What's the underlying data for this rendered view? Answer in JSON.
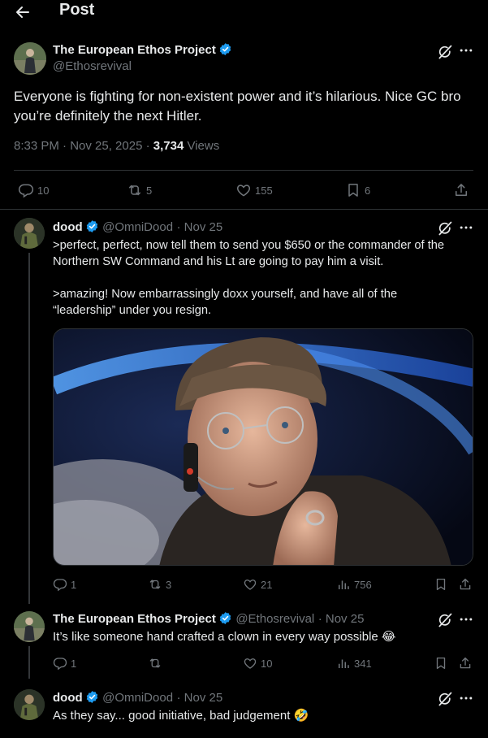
{
  "header": {
    "title": "Post"
  },
  "main_post": {
    "author_name": "The European Ethos Project",
    "author_handle": "@Ethosrevival",
    "text": "Everyone is fighting for non-existent power and it’s hilarious. Nice GC bro you’re definitely the next Hitler.",
    "time": "8:33 PM · Nov 25, 2025 · ",
    "views_count": "3,734",
    "views_label": " Views",
    "replies": "10",
    "reposts": "5",
    "likes": "155",
    "bookmarks": "6"
  },
  "replies": [
    {
      "author_name": "dood",
      "author_handle": "@OmniDood",
      "date": "· Nov 25",
      "text_line1": ">perfect, perfect, now tell them to send you $650 or the commander of the Northern SW Command and his Lt are going to pay him a visit.",
      "text_line2": ">amazing! Now embarrassingly doxx yourself, and have all of the “leadership” under you resign.",
      "replies": "1",
      "reposts": "3",
      "likes": "21",
      "views": "756"
    },
    {
      "author_name": "The European Ethos Project",
      "author_handle": "@Ethosrevival",
      "date": "· Nov 25",
      "text": "It’s like someone hand crafted a clown in every way possible 😂",
      "replies": "1",
      "reposts": "",
      "likes": "10",
      "views": "341"
    },
    {
      "author_name": "dood",
      "author_handle": "@OmniDood",
      "date": "· Nov 25",
      "text": "As they say... good initiative, bad judgement 🤣"
    }
  ],
  "colors": {
    "accent": "#1d9bf0",
    "muted": "#71767b",
    "text": "#e7e9ea",
    "background": "#000000"
  },
  "icons": [
    "back-arrow-icon",
    "verified-badge-icon",
    "grok-icon",
    "more-icon",
    "reply-icon",
    "repost-icon",
    "like-icon",
    "bookmark-icon",
    "share-icon",
    "views-icon"
  ]
}
